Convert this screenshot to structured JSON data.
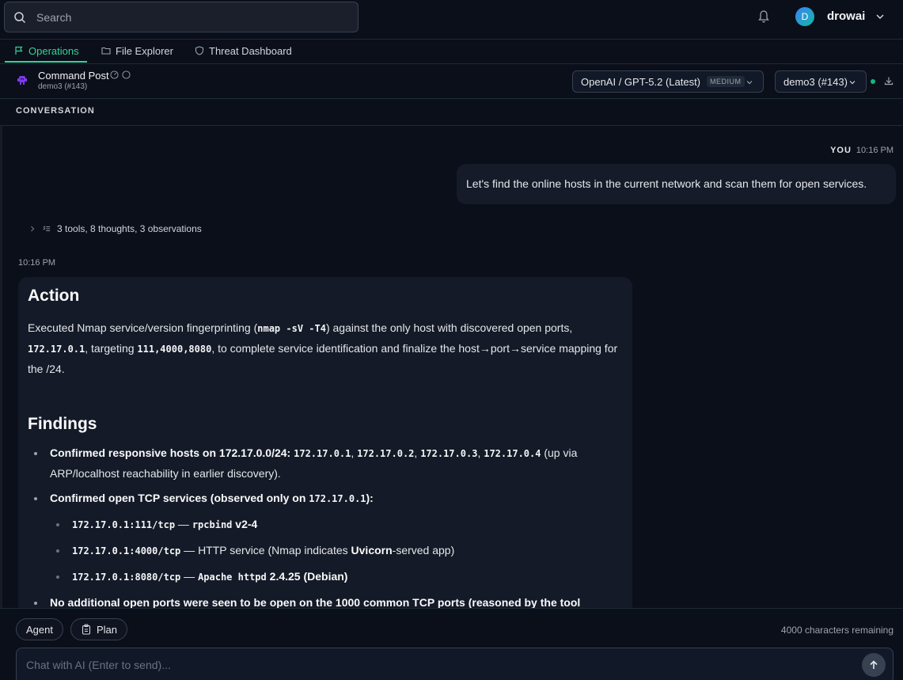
{
  "search": {
    "placeholder": "Search"
  },
  "user": {
    "initial": "D",
    "name": "drowai"
  },
  "tabs": [
    {
      "label": "Operations",
      "icon": "flag-icon",
      "active": true
    },
    {
      "label": "File Explorer",
      "icon": "folder-icon"
    },
    {
      "label": "Threat Dashboard",
      "icon": "shield-icon"
    }
  ],
  "header": {
    "title": "Command Post",
    "subtitle": "demo3 (#143)",
    "model": "OpenAI / GPT-5.2 (Latest)",
    "model_badge": "MEDIUM",
    "flow": "demo3 (#143)"
  },
  "section": {
    "label": "CONVERSATION"
  },
  "messages": {
    "user": {
      "author": "YOU",
      "time": "10:16 PM",
      "text": "Let's find the online hosts in the current network and scan them for open services."
    },
    "summary": "3 tools, 8 thoughts, 3 observations",
    "ai": {
      "time": "10:16 PM",
      "action_heading": "Action",
      "action_p1": "Executed Nmap service/version fingerprinting (",
      "action_code1": "nmap -sV -T4",
      "action_p2": ") against the only host with discovered open ports,",
      "action_code2": "172.17.0.1",
      "action_p3": ", targeting ",
      "action_code3": "111,4000,8080",
      "action_p4": ", to complete service identification and finalize the host→port→service mapping for the /24.",
      "findings_heading": "Findings",
      "f1_label": "Confirmed responsive hosts on 172.17.0.0/24:",
      "f1_hosts": [
        "172.17.0.1",
        "172.17.0.2",
        "172.17.0.3",
        "172.17.0.4"
      ],
      "f1_sep": ", ",
      "f1_tail": " (up via ARP/localhost reachability in earlier discovery).",
      "f2_label": "Confirmed open TCP services (observed only on ",
      "f2_code": "172.17.0.1",
      "f2_tail": "):",
      "services": [
        {
          "port": "172.17.0.1:111/tcp",
          "dash": " — ",
          "svc_code": "rpcbind",
          "svc_text": " v2-4",
          "svc_bold": ""
        },
        {
          "port": "172.17.0.1:4000/tcp",
          "dash": " — ",
          "svc_text": "HTTP service (Nmap indicates ",
          "svc_bold": "Uvicorn",
          "svc_text2": "-served app)"
        },
        {
          "port": "172.17.0.1:8080/tcp",
          "dash": " — ",
          "svc_code": "Apache httpd",
          "svc_text": " 2.4.25 (Debian)"
        }
      ],
      "f3_partial": "No additional open ports were seen to be open on the 1000 common TCP ports (reasoned by the tool scans)..."
    }
  },
  "input": {
    "mode_agent": "Agent",
    "mode_plan": "Plan",
    "chars_remaining": "4000 characters remaining",
    "placeholder": "Chat with AI (Enter to send)..."
  },
  "colors": {
    "accent": "#34d399",
    "status": "#10b981",
    "background": "#0b0f1a"
  }
}
